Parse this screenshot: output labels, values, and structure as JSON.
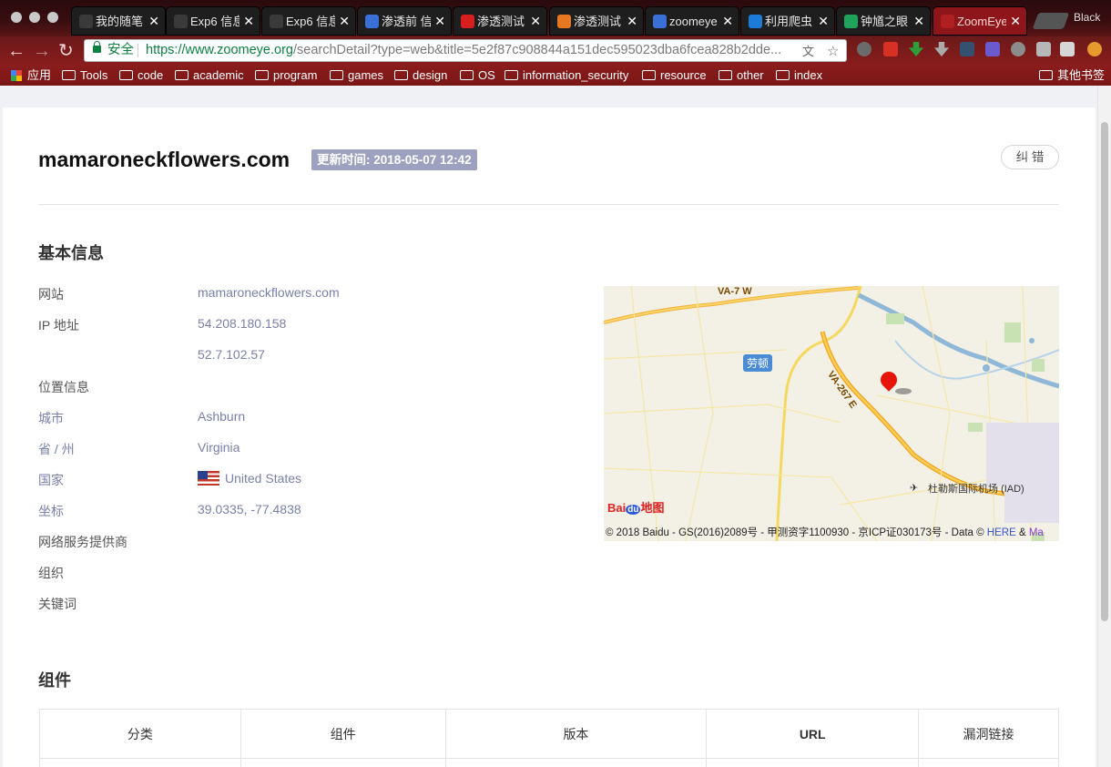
{
  "browser": {
    "tabs": [
      {
        "title": "我的随笔",
        "favicon_color": "#3a3a3a"
      },
      {
        "title": "Exp6 信息",
        "favicon_color": "#3a3a3a"
      },
      {
        "title": "Exp6 信息",
        "favicon_color": "#3a3a3a"
      },
      {
        "title": "渗透前 信",
        "favicon_color": "#3b6fd8"
      },
      {
        "title": "渗透测试",
        "favicon_color": "#d81e1e"
      },
      {
        "title": "渗透测试",
        "favicon_color": "#e87722"
      },
      {
        "title": "zoomeye",
        "favicon_color": "#3b6fd8"
      },
      {
        "title": "利用爬虫",
        "favicon_color": "#1c7ad8"
      },
      {
        "title": "钟馗之眼",
        "favicon_color": "#1fa35a"
      },
      {
        "title": "ZoomEye",
        "favicon_color": "#b02020",
        "active": true
      }
    ],
    "close_glyph": "✕",
    "profile_name": "Black",
    "secure_label": "安全",
    "url_host": "https://www.zoomeye.org",
    "url_rest": "/searchDetail?type=web&title=5e2f87c908844a151dec595023dba6fcea828b2dde...",
    "bookmarks": [
      "应用",
      "Tools",
      "code",
      "academic",
      "program",
      "games",
      "design",
      "OS",
      "information_security",
      "resource",
      "other",
      "index"
    ],
    "other_bookmarks": "其他书签"
  },
  "header": {
    "site": "mamaroneckflowers.com",
    "update_label": "更新时间: 2018-05-07 12:42",
    "report_button": "纠 错"
  },
  "basic_info": {
    "title": "基本信息",
    "website_label": "网站",
    "website": "mamaroneckflowers.com",
    "ip_label": "IP 地址",
    "ips": [
      "54.208.180.158",
      "52.7.102.57"
    ],
    "location_label": "位置信息",
    "city_label": "城市",
    "city": "Ashburn",
    "state_label": "省 / 州",
    "state": "Virginia",
    "country_label": "国家",
    "country": "United States",
    "coords_label": "坐标",
    "coords": "39.0335, -77.4838",
    "isp_label": "网络服务提供商",
    "org_label": "组织",
    "keywords_label": "关键词"
  },
  "map": {
    "road_va7": "VA-7  W",
    "road_va267": "VA-267  E",
    "city_tag": "劳顿",
    "airport": "杜勒斯国际机场 (IAD)",
    "baidu_logo": "Bai",
    "baidu_du": "du",
    "baidu_suffix": "地图",
    "copyright": "© 2018 Baidu - GS(2016)2089号 - 甲测资字1100930 - 京ICP证030173号 - Data © ",
    "here_link": "HERE",
    "amp": " & ",
    "ma_link": "Ma"
  },
  "components": {
    "title": "组件",
    "columns": [
      "分类",
      "组件",
      "版本",
      "URL",
      "漏洞链接"
    ]
  }
}
